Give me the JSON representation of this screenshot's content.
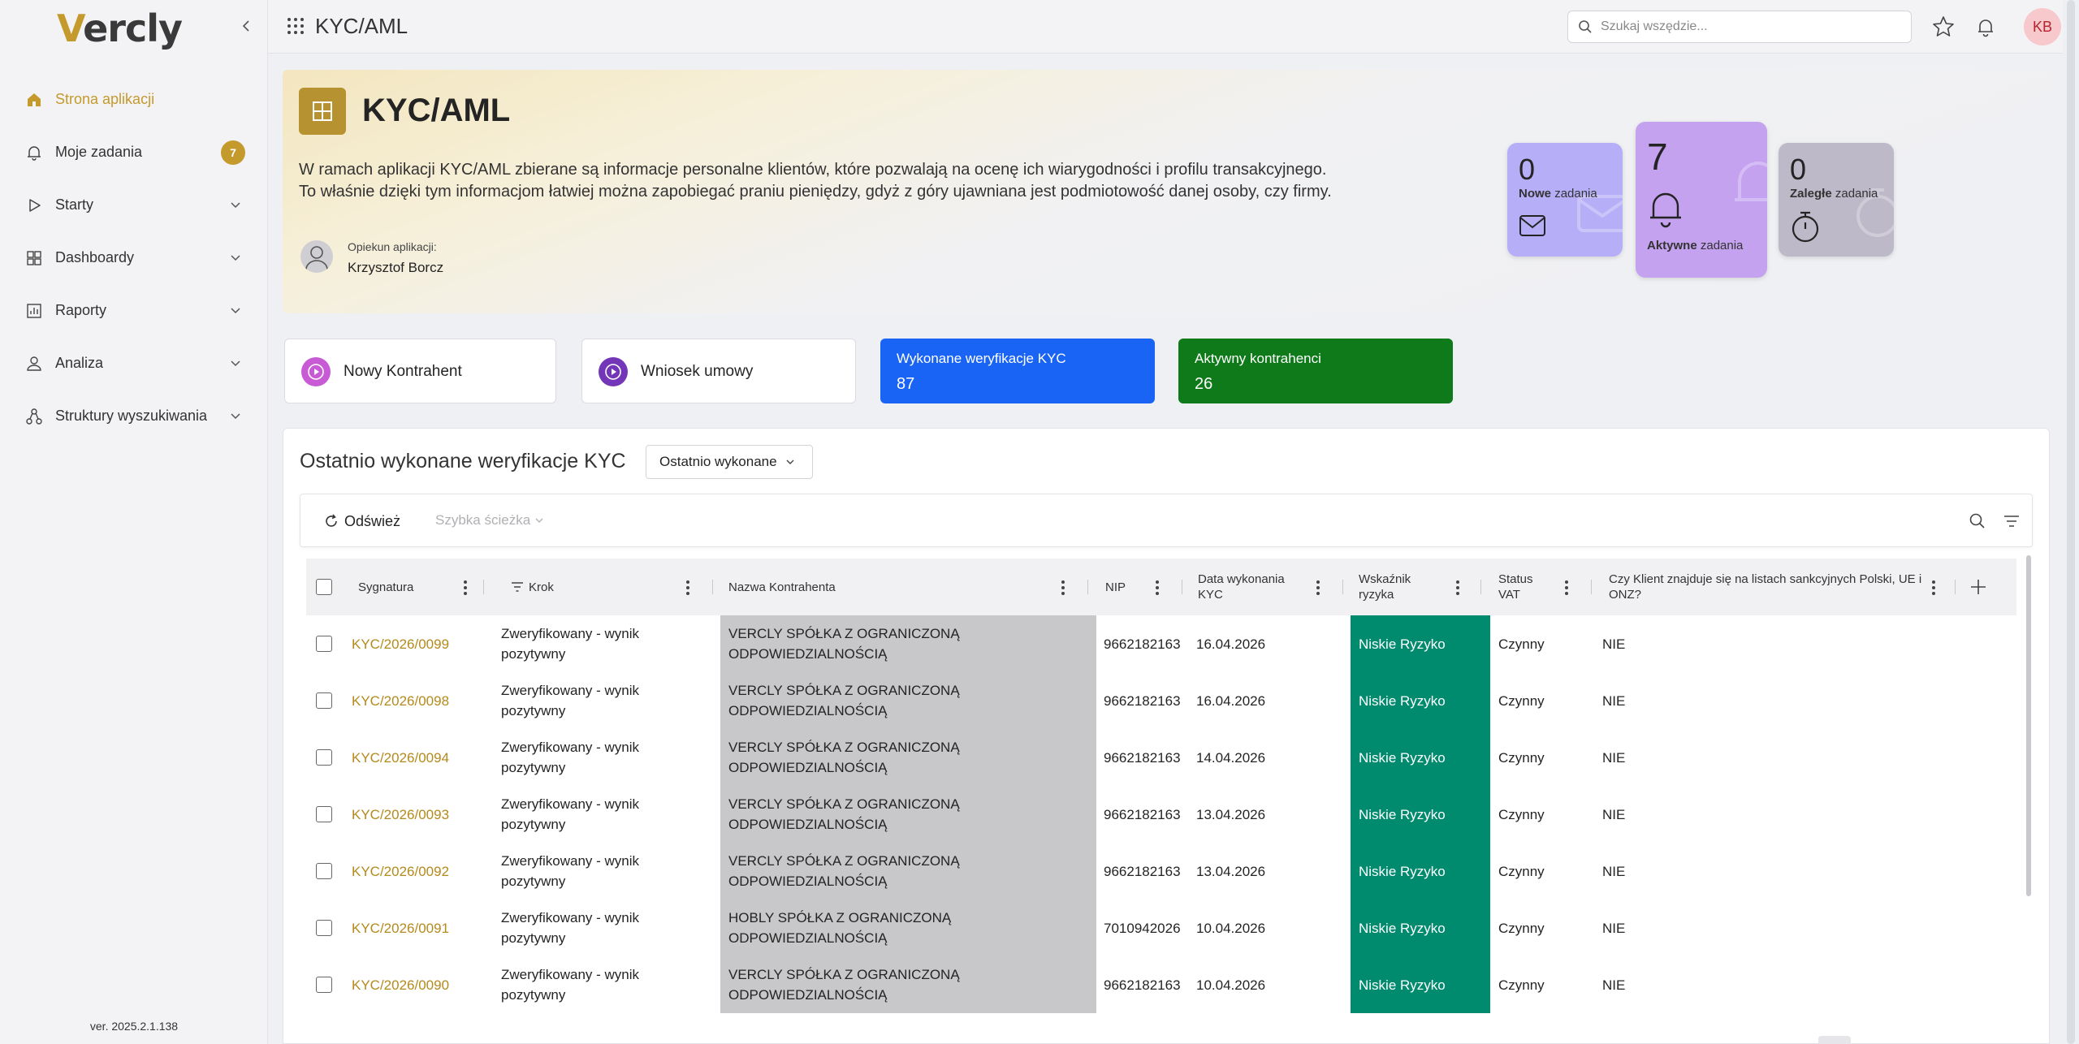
{
  "sidebar": {
    "logo": {
      "first": "V",
      "rest": "ercly"
    },
    "items": [
      {
        "label": "Strona aplikacji",
        "icon": "home-icon",
        "active": true
      },
      {
        "label": "Moje zadania",
        "icon": "bell-icon",
        "badge": "7"
      },
      {
        "label": "Starty",
        "icon": "play-icon"
      },
      {
        "label": "Dashboardy",
        "icon": "dashboard-icon"
      },
      {
        "label": "Raporty",
        "icon": "report-icon"
      },
      {
        "label": "Analiza",
        "icon": "analysis-icon"
      },
      {
        "label": "Struktury wyszukiwania",
        "icon": "tree-icon"
      }
    ],
    "version": "ver. 2025.2.1.138"
  },
  "topbar": {
    "title": "KYC/AML",
    "search_placeholder": "Szukaj wszędzie...",
    "avatar_initials": "KB"
  },
  "hero": {
    "title": "KYC/AML",
    "description_line1": "W ramach aplikacji KYC/AML zbierane są informacje personalne klientów, które pozwalają na ocenę ich wiarygodności i profilu transakcyjnego.",
    "description_line2": "To właśnie dzięki tym informacjom łatwiej można zapobiegać praniu pieniędzy, gdyż z góry ujawniana jest podmiotowość danej osoby, czy firmy.",
    "owner_label": "Opiekun aplikacji:",
    "owner_name": "Krzysztof Borcz",
    "task_cards": {
      "new": {
        "count": "0",
        "bold": "Nowe",
        "suffix": "zadania"
      },
      "active": {
        "count": "7",
        "bold": "Aktywne",
        "suffix": "zadania"
      },
      "overdue": {
        "count": "0",
        "bold": "Zaległe",
        "suffix": "zadania"
      }
    }
  },
  "tiles": {
    "new_contractor": "Nowy Kontrahent",
    "contract_request": "Wniosek umowy",
    "kyc_done": {
      "title": "Wykonane weryfikacje KYC",
      "value": "87",
      "color": "#1a64f5"
    },
    "active_contractors": {
      "title": "Aktywny kontrahenci",
      "value": "26",
      "color": "#0f7a19"
    }
  },
  "panel": {
    "title": "Ostatnio wykonane weryfikacje KYC",
    "view_selector": "Ostatnio wykonane",
    "toolbar": {
      "refresh": "Odśwież",
      "quick_path": "Szybka ścieżka"
    },
    "columns": {
      "signature": "Sygnatura",
      "step": "Krok",
      "name": "Nazwa Kontrahenta",
      "nip": "NIP",
      "date_line1": "Data wykonania",
      "date_line2": "KYC",
      "risk_line1": "Wskaźnik",
      "risk_line2": "ryzyka",
      "vat_line1": "Status",
      "vat_line2": "VAT",
      "sanctions_line1": "Czy Klient znajduje się na listach sankcyjnych Polski, UE i",
      "sanctions_line2": "ONZ?"
    },
    "rows": [
      {
        "signature": "KYC/2026/0099",
        "step1": "Zweryfikowany - wynik",
        "step2": "pozytywny",
        "name1": "VERCLY SPÓŁKA Z OGRANICZONĄ",
        "name2": "ODPOWIEDZIALNOŚCIĄ",
        "nip": "9662182163",
        "date": "16.04.2026",
        "risk": "Niskie Ryzyko",
        "vat": "Czynny",
        "sanctions": "NIE"
      },
      {
        "signature": "KYC/2026/0098",
        "step1": "Zweryfikowany - wynik",
        "step2": "pozytywny",
        "name1": "VERCLY SPÓŁKA Z OGRANICZONĄ",
        "name2": "ODPOWIEDZIALNOŚCIĄ",
        "nip": "9662182163",
        "date": "16.04.2026",
        "risk": "Niskie Ryzyko",
        "vat": "Czynny",
        "sanctions": "NIE"
      },
      {
        "signature": "KYC/2026/0094",
        "step1": "Zweryfikowany - wynik",
        "step2": "pozytywny",
        "name1": "VERCLY SPÓŁKA Z OGRANICZONĄ",
        "name2": "ODPOWIEDZIALNOŚCIĄ",
        "nip": "9662182163",
        "date": "14.04.2026",
        "risk": "Niskie Ryzyko",
        "vat": "Czynny",
        "sanctions": "NIE"
      },
      {
        "signature": "KYC/2026/0093",
        "step1": "Zweryfikowany - wynik",
        "step2": "pozytywny",
        "name1": "VERCLY SPÓŁKA Z OGRANICZONĄ",
        "name2": "ODPOWIEDZIALNOŚCIĄ",
        "nip": "9662182163",
        "date": "13.04.2026",
        "risk": "Niskie Ryzyko",
        "vat": "Czynny",
        "sanctions": "NIE"
      },
      {
        "signature": "KYC/2026/0092",
        "step1": "Zweryfikowany - wynik",
        "step2": "pozytywny",
        "name1": "VERCLY SPÓŁKA Z OGRANICZONĄ",
        "name2": "ODPOWIEDZIALNOŚCIĄ",
        "nip": "9662182163",
        "date": "13.04.2026",
        "risk": "Niskie Ryzyko",
        "vat": "Czynny",
        "sanctions": "NIE"
      },
      {
        "signature": "KYC/2026/0091",
        "step1": "Zweryfikowany - wynik",
        "step2": "pozytywny",
        "name1": "HOBLY SPÓŁKA Z OGRANICZONĄ",
        "name2": "ODPOWIEDZIALNOŚCIĄ",
        "nip": "7010942026",
        "date": "10.04.2026",
        "risk": "Niskie Ryzyko",
        "vat": "Czynny",
        "sanctions": "NIE"
      },
      {
        "signature": "KYC/2026/0090",
        "step1": "Zweryfikowany - wynik",
        "step2": "pozytywny",
        "name1": "VERCLY SPÓŁKA Z OGRANICZONĄ",
        "name2": "ODPOWIEDZIALNOŚCIĄ",
        "nip": "9662182163",
        "date": "10.04.2026",
        "risk": "Niskie Ryzyko",
        "vat": "Czynny",
        "sanctions": "NIE"
      }
    ]
  },
  "colors": {
    "accent": "#c49a2c",
    "risk_low": "#008a6e",
    "name_cell": "#c8c8ca",
    "card_new": "#b7aef8",
    "card_active": "#c4a2f0",
    "card_overdue": "#bdb9c8"
  }
}
